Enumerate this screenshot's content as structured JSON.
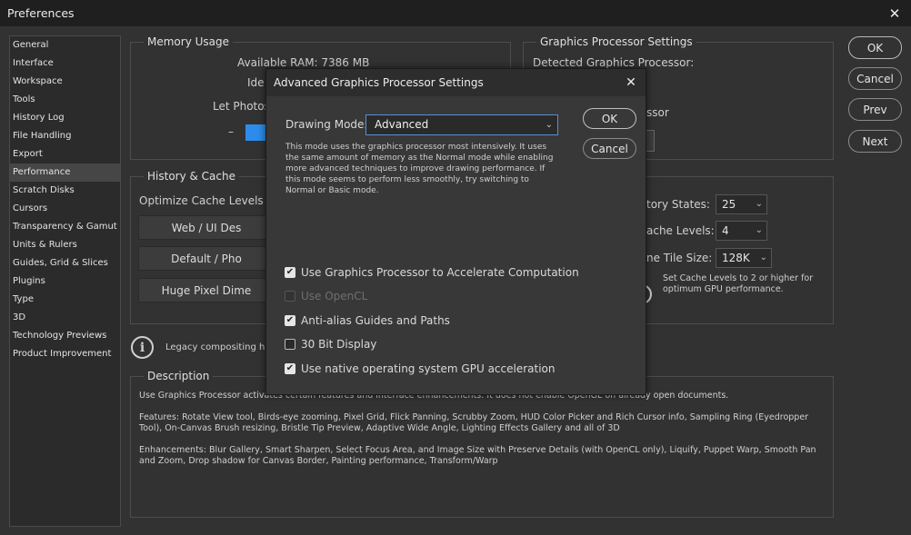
{
  "window": {
    "title": "Preferences",
    "close_glyph": "✕"
  },
  "sidebar": {
    "items": [
      "General",
      "Interface",
      "Workspace",
      "Tools",
      "History Log",
      "File Handling",
      "Export",
      "Performance",
      "Scratch Disks",
      "Cursors",
      "Transparency & Gamut",
      "Units & Rulers",
      "Guides, Grid & Slices",
      "Plugins",
      "Type",
      "3D",
      "Technology Previews",
      "Product Improvement"
    ],
    "selected_index": 7
  },
  "memory": {
    "title": "Memory Usage",
    "available_ram": "Available RAM:  7386 MB",
    "ideal_prefix": "Ide",
    "let_prefix": "Let Photos",
    "minus": "–"
  },
  "gpu": {
    "title": "Graphics Processor Settings",
    "detected": "Detected Graphics Processor:",
    "use_suffix": "ssor"
  },
  "history": {
    "title": "History & Cache",
    "optimize_prefix": "Optimize Cache Levels a",
    "buttons": [
      "Web / UI Des",
      "Default / Pho",
      "Huge Pixel Dime"
    ],
    "history_states_label": "tory States:",
    "history_states_value": "25",
    "cache_levels_label": "ache Levels:",
    "cache_levels_value": "4",
    "tile_size_label": "ne Tile Size:",
    "tile_size_value": "128K",
    "hint": "Set Cache Levels to 2 or higher for\noptimum GPU performance."
  },
  "legacy": {
    "text": "Legacy compositing has",
    "icon": "info-icon"
  },
  "description": {
    "title": "Description",
    "p1": "Use Graphics Processor activates certain features and interface enhancements. It does not enable OpenGL on already open documents.",
    "p2": "Features: Rotate View tool, Birds-eye zooming, Pixel Grid, Flick Panning, Scrubby Zoom, HUD Color Picker and Rich Cursor info, Sampling Ring (Eyedropper Tool), On-Canvas Brush resizing, Bristle Tip Preview, Adaptive Wide Angle, Lighting Effects Gallery and all of 3D",
    "p3": "Enhancements: Blur Gallery, Smart Sharpen, Select Focus Area, and Image Size with Preserve Details (with OpenCL only), Liquify, Puppet Warp, Smooth Pan and Zoom, Drop shadow for Canvas Border, Painting performance, Transform/Warp"
  },
  "right_buttons": {
    "ok": "OK",
    "cancel": "Cancel",
    "prev": "Prev",
    "next": "Next"
  },
  "dialog": {
    "title": "Advanced Graphics Processor Settings",
    "close_glyph": "✕",
    "drawing_mode_label": "Drawing Mode:",
    "drawing_mode_value": "Advanced",
    "note": "This mode uses the graphics processor most intensively.  It uses the same amount of memory as the Normal mode while enabling more advanced techniques to improve drawing performance.  If this mode seems to perform less smoothly, try switching to Normal or Basic mode.",
    "ok": "OK",
    "cancel": "Cancel",
    "checkboxes": [
      {
        "label": "Use Graphics Processor to Accelerate Computation",
        "checked": true,
        "disabled": false
      },
      {
        "label": "Use OpenCL",
        "checked": false,
        "disabled": true
      },
      {
        "label": "Anti-alias Guides and Paths",
        "checked": true,
        "disabled": false
      },
      {
        "label": "30 Bit Display",
        "checked": false,
        "disabled": false
      },
      {
        "label": "Use native operating system GPU acceleration",
        "checked": true,
        "disabled": false
      }
    ]
  }
}
